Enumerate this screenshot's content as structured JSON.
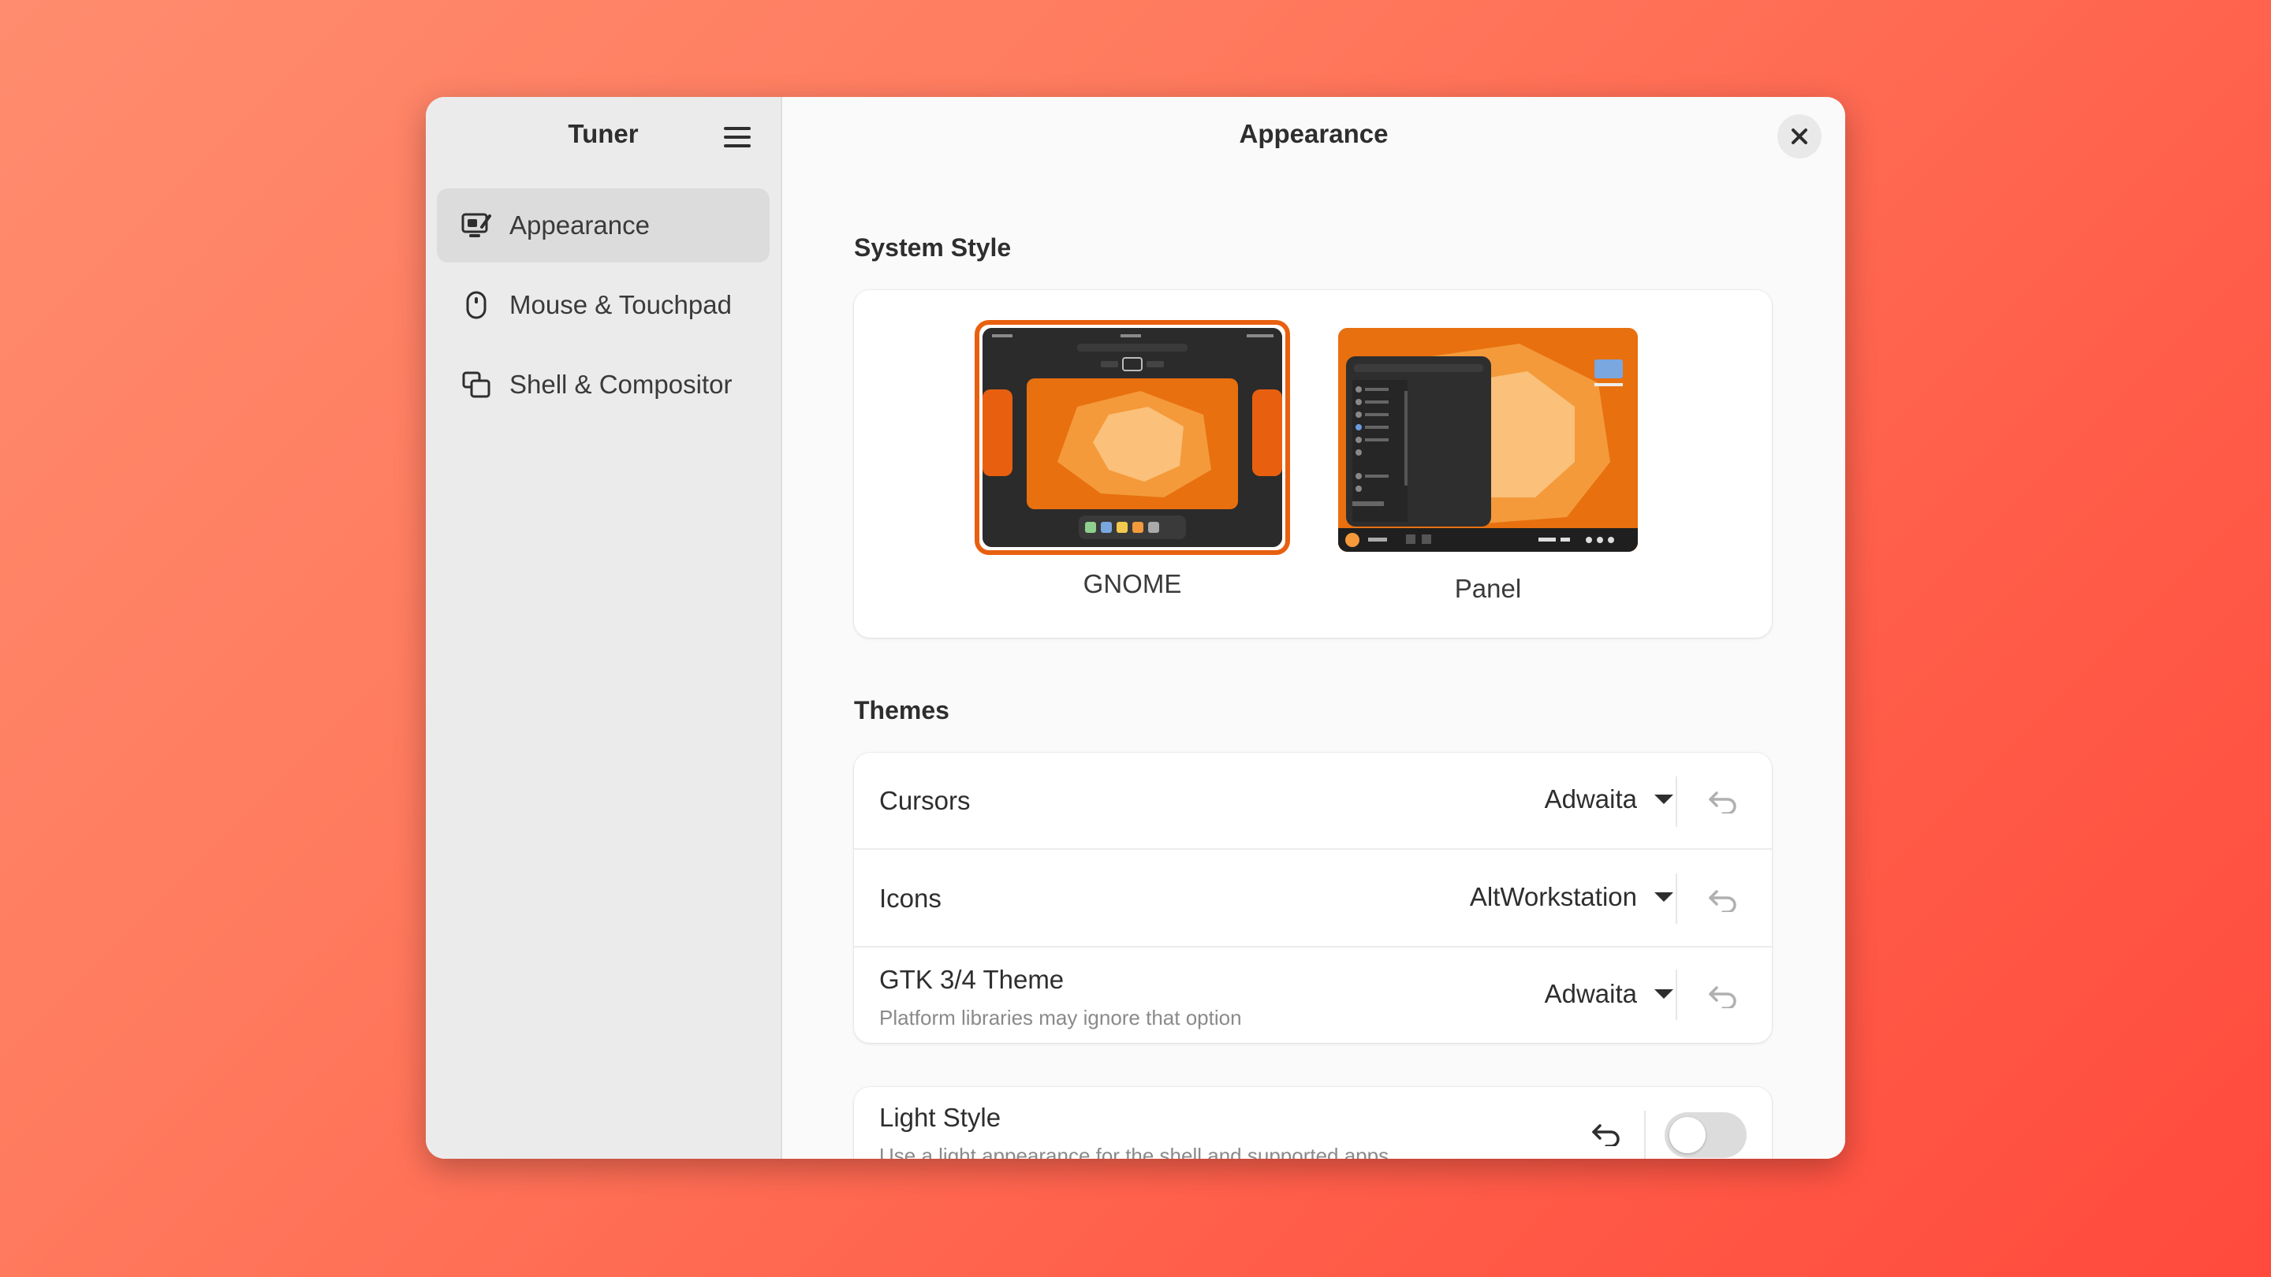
{
  "sidebar": {
    "title": "Tuner",
    "menu_icon": "hamburger-menu-icon",
    "items": [
      {
        "label": "Appearance",
        "icon": "appearance-icon",
        "active": true
      },
      {
        "label": "Mouse & Touchpad",
        "icon": "mouse-icon",
        "active": false
      },
      {
        "label": "Shell & Compositor",
        "icon": "windows-overlap-icon",
        "active": false
      }
    ]
  },
  "content": {
    "title": "Appearance",
    "close_icon": "close-icon",
    "system_style": {
      "heading": "System Style",
      "options": [
        {
          "label": "GNOME",
          "selected": true
        },
        {
          "label": "Panel",
          "selected": false
        }
      ]
    },
    "themes": {
      "heading": "Themes",
      "rows": [
        {
          "label": "Cursors",
          "value": "Adwaita",
          "subtitle": ""
        },
        {
          "label": "Icons",
          "value": "AltWorkstation",
          "subtitle": ""
        },
        {
          "label": "GTK 3/4 Theme",
          "value": "Adwaita",
          "subtitle": "Platform libraries may ignore that option"
        }
      ]
    },
    "light_style": {
      "label": "Light Style",
      "subtitle": "Use a light appearance for the shell and supported apps",
      "enabled": false
    }
  },
  "colors": {
    "accent": "#e8600f",
    "background_gradient_start": "#ff8c6e",
    "background_gradient_end": "#ff4a3d"
  }
}
